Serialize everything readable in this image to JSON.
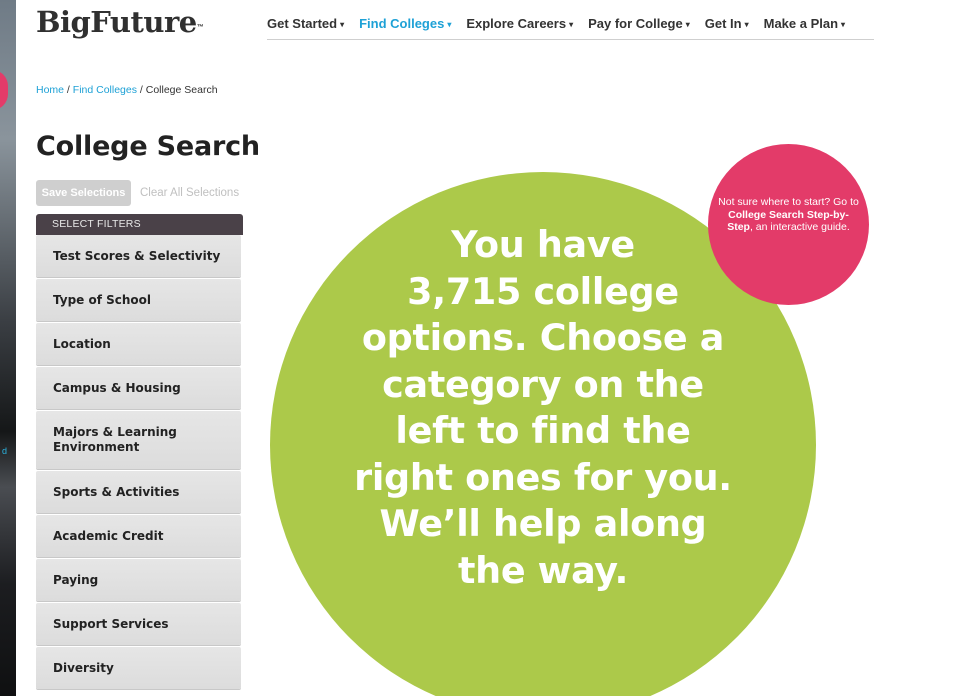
{
  "brand": {
    "name": "BigFuture",
    "trademark": "™"
  },
  "nav": {
    "items": [
      {
        "label": "Get Started",
        "active": false
      },
      {
        "label": "Find Colleges",
        "active": true
      },
      {
        "label": "Explore Careers",
        "active": false
      },
      {
        "label": "Pay for College",
        "active": false
      },
      {
        "label": "Get In",
        "active": false
      },
      {
        "label": "Make a Plan",
        "active": false
      }
    ],
    "caret": "▾"
  },
  "breadcrumb": {
    "home": "Home",
    "sep1": " / ",
    "parent": "Find Colleges",
    "sep2": " / ",
    "current": "College Search"
  },
  "page": {
    "title": "College Search"
  },
  "actions": {
    "save_label": "Save Selections",
    "clear_label": "Clear All Selections"
  },
  "filters": {
    "header": "SELECT FILTERS",
    "items": [
      {
        "label": "Test Scores & Selectivity"
      },
      {
        "label": "Type of School"
      },
      {
        "label": "Location"
      },
      {
        "label": "Campus & Housing"
      },
      {
        "label": "Majors & Learning Environment"
      },
      {
        "label": "Sports & Activities"
      },
      {
        "label": "Academic Credit"
      },
      {
        "label": "Paying"
      },
      {
        "label": "Support Services"
      },
      {
        "label": "Diversity"
      }
    ]
  },
  "results": {
    "line1": "You have",
    "line2": "3,715 college",
    "line3": "options. Choose a",
    "line4": "category on the",
    "line5": "left to find the",
    "line6": "right ones for you.",
    "line7": "We’ll help along",
    "line8": "the way."
  },
  "guide": {
    "intro": "Not sure where to start? Go to ",
    "link": "College Search Step-by-Step",
    "outro": ", an interactive guide."
  },
  "colors": {
    "accent_blue": "#1ea1d6",
    "green_circle": "#acc94a",
    "pink_circle": "#e33b69",
    "filter_header": "#4a4148"
  }
}
